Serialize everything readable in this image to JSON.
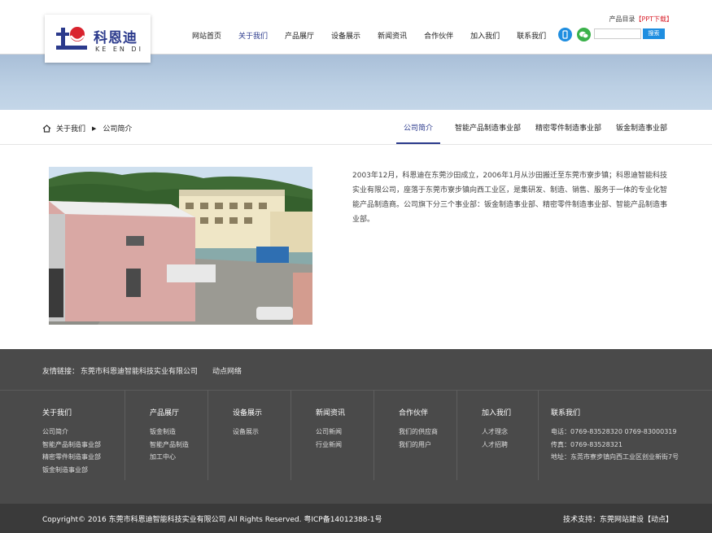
{
  "header": {
    "logo_cn": "科恩迪",
    "logo_en": "KE EN DI",
    "top_link_catalog": "产品目录",
    "top_link_ppt": "【PPT下载】",
    "nav": [
      {
        "label": "网站首页",
        "active": false
      },
      {
        "label": "关于我们",
        "active": true
      },
      {
        "label": "产品展厅",
        "active": false
      },
      {
        "label": "设备展示",
        "active": false
      },
      {
        "label": "新闻资讯",
        "active": false
      },
      {
        "label": "合作伙伴",
        "active": false
      },
      {
        "label": "加入我们",
        "active": false
      },
      {
        "label": "联系我们",
        "active": false
      }
    ],
    "search_button": "搜索",
    "search_value": ""
  },
  "breadcrumb": {
    "section": "关于我们",
    "current": "公司简介"
  },
  "subnav": [
    {
      "label": "公司简介",
      "active": true
    },
    {
      "label": "智能产品制造事业部",
      "active": false
    },
    {
      "label": "精密零件制造事业部",
      "active": false
    },
    {
      "label": "钣金制造事业部",
      "active": false
    }
  ],
  "about": {
    "text": "2003年12月，科恩迪在东莞沙田成立，2006年1月从沙田搬迁至东莞市寮步镇；科恩迪智能科技实业有限公司，座落于东莞市寮步镇向西工业区，是集研发、制造、销售、服务于一体的专业化智能产品制造商。公司旗下分三个事业部：钣金制造事业部、精密零件制造事业部、智能产品制造事业部。"
  },
  "friend_links": {
    "label": "友情链接：",
    "links": [
      "东莞市科恩迪智能科技实业有限公司",
      "动点网络"
    ]
  },
  "footer": {
    "columns": [
      {
        "title": "关于我们",
        "items": [
          "公司简介",
          "智能产品制造事业部",
          "精密零件制造事业部",
          "钣金制造事业部"
        ]
      },
      {
        "title": "产品展厅",
        "items": [
          "钣金制造",
          "智能产品制造",
          "加工中心"
        ]
      },
      {
        "title": "设备展示",
        "items": [
          "设备展示"
        ]
      },
      {
        "title": "新闻资讯",
        "items": [
          "公司新闻",
          "行业新闻"
        ]
      },
      {
        "title": "合作伙伴",
        "items": [
          "我们的供应商",
          "我们的用户"
        ]
      },
      {
        "title": "加入我们",
        "items": [
          "人才理念",
          "人才招聘"
        ]
      },
      {
        "title": "联系我们",
        "items": [
          "电话：0769-83528320 0769-83000319",
          "传真：0769-83528321",
          "地址：东莞市寮步镇向西工业区创业新街7号"
        ]
      }
    ]
  },
  "copyright": {
    "left": "Copyright© 2016 东莞市科恩迪智能科技实业有限公司 All Rights Reserved. 粤ICP备14012388-1号",
    "right": "技术支持：东莞网站建设【动点】"
  },
  "colors": {
    "brand": "#2b3a8c",
    "accent_red": "#d9232e",
    "link_blue": "#1f8ee0",
    "wechat_green": "#3ab14a",
    "footer_bg": "#4a4a4a",
    "copyright_bg": "#3a3a3a"
  }
}
